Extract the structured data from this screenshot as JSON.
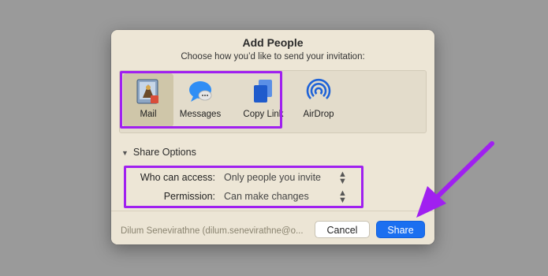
{
  "dialog": {
    "title": "Add People",
    "subtitle": "Choose how you’d like to send your invitation:"
  },
  "apps": [
    {
      "label": "Mail",
      "icon": "mail-icon",
      "selected": true
    },
    {
      "label": "Messages",
      "icon": "messages-icon"
    },
    {
      "label": "Copy Link",
      "icon": "copy-link-icon"
    },
    {
      "label": "AirDrop",
      "icon": "airdrop-icon"
    }
  ],
  "share_options": {
    "toggle_label": "Share Options",
    "who_label": "Who can access:",
    "who_value": "Only people you invite",
    "permission_label": "Permission:",
    "permission_value": "Can make changes"
  },
  "footer": {
    "owner": "Dilum Senevirathne (dilum.senevirathne@o...",
    "cancel_label": "Cancel",
    "share_label": "Share"
  },
  "colors": {
    "accent": "#1b6ff0",
    "highlight": "#a020f0",
    "dialog_bg": "#ede6d6"
  }
}
